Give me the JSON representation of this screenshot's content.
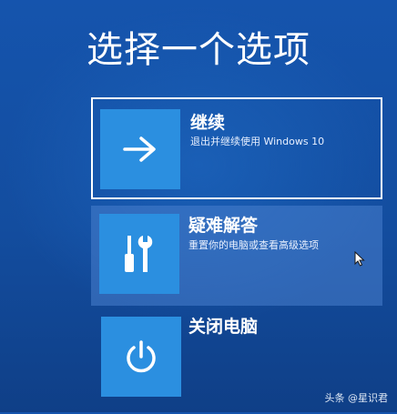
{
  "header": {
    "title": "选择一个选项"
  },
  "options": [
    {
      "id": "continue",
      "label": "继续",
      "description": "退出并继续使用 Windows 10",
      "icon": "arrow-right-icon",
      "focused": true
    },
    {
      "id": "troubleshoot",
      "label": "疑难解答",
      "description": "重置你的电脑或查看高级选项",
      "icon": "tools-icon",
      "hovered": true
    },
    {
      "id": "shutdown",
      "label": "关闭电脑",
      "icon": "power-icon"
    }
  ],
  "watermark": "头条 @星识君",
  "colors": {
    "background": "#1554ad",
    "tile": "#2b8fe0",
    "hover": "#4980ce",
    "text": "#ffffff"
  }
}
